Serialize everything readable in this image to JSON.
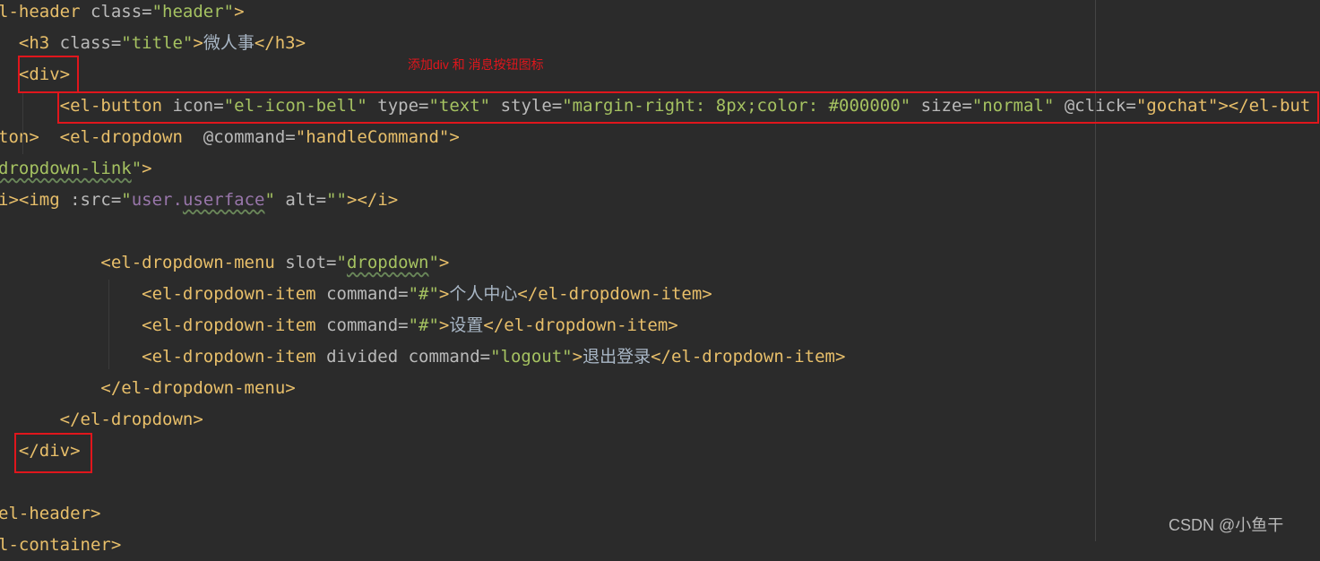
{
  "code_lines": [
    [
      {
        "t": "l-header ",
        "c": "tag"
      },
      {
        "t": "class=",
        "c": "attr"
      },
      {
        "t": "\"header\"",
        "c": "val"
      },
      {
        "t": ">",
        "c": "tag"
      }
    ],
    [
      {
        "t": "  <h3 ",
        "c": "tag"
      },
      {
        "t": "class=",
        "c": "attr"
      },
      {
        "t": "\"title\"",
        "c": "val"
      },
      {
        "t": ">",
        "c": "tag"
      },
      {
        "t": "微人事",
        "c": "txt"
      },
      {
        "t": "</h3>",
        "c": "tag"
      }
    ],
    [
      {
        "t": "  <div>",
        "c": "tag"
      }
    ],
    [
      {
        "t": "      <el-button ",
        "c": "tag"
      },
      {
        "t": "icon=",
        "c": "attr"
      },
      {
        "t": "\"el-icon-bell\"",
        "c": "val"
      },
      {
        "t": " type=",
        "c": "attr"
      },
      {
        "t": "\"text\"",
        "c": "val"
      },
      {
        "t": " style=",
        "c": "attr"
      },
      {
        "t": "\"margin-right: 8px;color: #000000\"",
        "c": "val"
      },
      {
        "t": " size=",
        "c": "attr"
      },
      {
        "t": "\"normal\"",
        "c": "val"
      },
      {
        "t": " @click=",
        "c": "attr"
      },
      {
        "t": "\"gochat\"",
        "c": "js"
      },
      {
        "t": "></el-button>",
        "c": "tag"
      }
    ],
    [
      {
        "t": "      <el-dropdown  ",
        "c": "tag"
      },
      {
        "t": "@command=",
        "c": "attr"
      },
      {
        "t": "\"handleCommand\"",
        "c": "js"
      },
      {
        "t": ">",
        "c": "tag"
      }
    ],
    [
      {
        "t": "dropdown-link",
        "c": "val wavy"
      },
      {
        "t": "\"",
        "c": "val"
      },
      {
        "t": ">",
        "c": "tag"
      }
    ],
    [
      {
        "t": "i><img ",
        "c": "tag"
      },
      {
        "t": ":src=",
        "c": "attr"
      },
      {
        "t": "\"",
        "c": "val"
      },
      {
        "t": "user.",
        "c": "prop"
      },
      {
        "t": "userface",
        "c": "prop wavy"
      },
      {
        "t": "\"",
        "c": "val"
      },
      {
        "t": " alt=",
        "c": "attr"
      },
      {
        "t": "\"\"",
        "c": "val"
      },
      {
        "t": "></i>",
        "c": "tag"
      }
    ],
    [],
    [
      {
        "t": "          <el-dropdown-menu ",
        "c": "tag"
      },
      {
        "t": "slot=",
        "c": "attr"
      },
      {
        "t": "\"",
        "c": "val"
      },
      {
        "t": "dropdown",
        "c": "val wavy"
      },
      {
        "t": "\"",
        "c": "val"
      },
      {
        "t": ">",
        "c": "tag"
      }
    ],
    [
      {
        "t": "              <el-dropdown-item ",
        "c": "tag"
      },
      {
        "t": "command=",
        "c": "attr"
      },
      {
        "t": "\"#\"",
        "c": "val"
      },
      {
        "t": ">",
        "c": "tag"
      },
      {
        "t": "个人中心",
        "c": "txt"
      },
      {
        "t": "</el-dropdown-item>",
        "c": "tag"
      }
    ],
    [
      {
        "t": "              <el-dropdown-item ",
        "c": "tag"
      },
      {
        "t": "command=",
        "c": "attr"
      },
      {
        "t": "\"#\"",
        "c": "val"
      },
      {
        "t": ">",
        "c": "tag"
      },
      {
        "t": "设置",
        "c": "txt"
      },
      {
        "t": "</el-dropdown-item>",
        "c": "tag"
      }
    ],
    [
      {
        "t": "              <el-dropdown-item ",
        "c": "tag"
      },
      {
        "t": "divided command=",
        "c": "attr"
      },
      {
        "t": "\"logout\"",
        "c": "val"
      },
      {
        "t": ">",
        "c": "tag"
      },
      {
        "t": "退出登录",
        "c": "txt"
      },
      {
        "t": "</el-dropdown-item>",
        "c": "tag"
      }
    ],
    [
      {
        "t": "          </el-dropdown-menu>",
        "c": "tag"
      }
    ],
    [
      {
        "t": "      </el-dropdown>",
        "c": "tag"
      }
    ],
    [
      {
        "t": "  </div>",
        "c": "tag"
      }
    ],
    [],
    [
      {
        "t": "el-header>",
        "c": "tag"
      }
    ],
    [
      {
        "t": "l-container>",
        "c": "tag"
      }
    ]
  ],
  "annotation": "添加div   和 消息按钮图标",
  "watermark": "CSDN @小鱼干",
  "colors": {
    "highlight_box": "#e0161c",
    "background": "#2b2b2b"
  }
}
